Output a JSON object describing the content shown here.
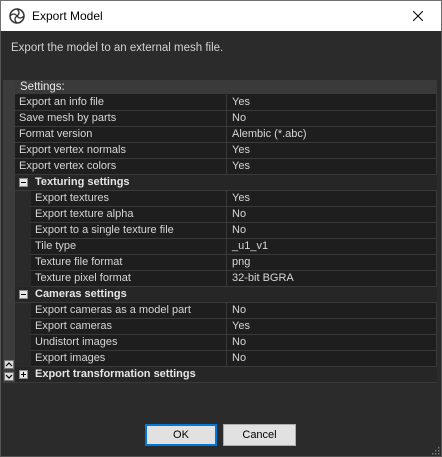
{
  "window": {
    "title": "Export Model",
    "description": "Export the model to an external mesh file."
  },
  "settings": {
    "header": "Settings:",
    "top_rows": [
      {
        "key": "Export an info file",
        "value": "Yes"
      },
      {
        "key": "Save mesh by parts",
        "value": "No"
      },
      {
        "key": "Format version",
        "value": "Alembic (*.abc)"
      },
      {
        "key": "Export vertex normals",
        "value": "Yes"
      },
      {
        "key": "Export vertex colors",
        "value": "Yes"
      }
    ],
    "texturing": {
      "label": "Texturing settings",
      "rows": [
        {
          "key": "Export textures",
          "value": "Yes"
        },
        {
          "key": "Export texture alpha",
          "value": "No"
        },
        {
          "key": "Export to a single texture file",
          "value": "No"
        },
        {
          "key": "Tile type",
          "value": "_u1_v1"
        },
        {
          "key": "Texture file format",
          "value": "png"
        },
        {
          "key": "Texture pixel format",
          "value": "32-bit BGRA"
        }
      ]
    },
    "cameras": {
      "label": "Cameras settings",
      "rows": [
        {
          "key": "Export cameras as a model part",
          "value": "No"
        },
        {
          "key": "Export cameras",
          "value": "Yes"
        },
        {
          "key": "Undistort images",
          "value": "No"
        },
        {
          "key": "Export images",
          "value": "No"
        }
      ]
    },
    "transformation": {
      "label": "Export transformation settings"
    }
  },
  "buttons": {
    "ok": "OK",
    "cancel": "Cancel"
  },
  "icons": {
    "app": "app-logo-icon",
    "close": "close-icon",
    "collapse": "minus-box-icon",
    "expand": "plus-box-icon",
    "scroll_up": "scroll-up-icon",
    "scroll_down": "scroll-down-icon",
    "grip": "resize-grip-icon"
  }
}
